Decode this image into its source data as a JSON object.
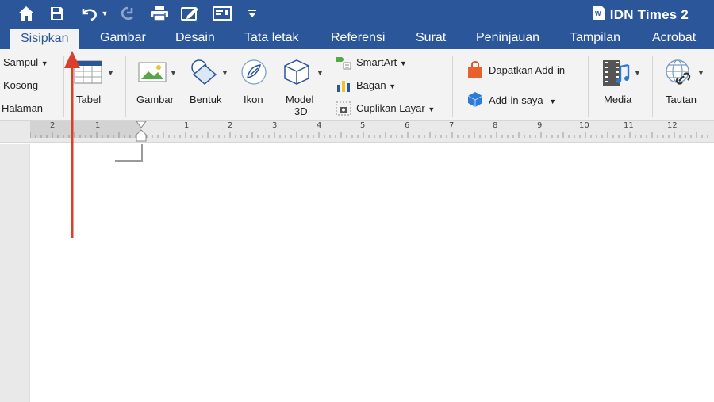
{
  "titlebar": {
    "document_title": "IDN Times 2",
    "icons": [
      "home-icon",
      "save-icon",
      "undo-icon",
      "redo-icon",
      "print-icon",
      "edit-icon",
      "mail-merge-icon",
      "customize-toolbar-icon",
      "word-doc-icon"
    ]
  },
  "tabs": [
    {
      "label": "Sisipkan",
      "active": true
    },
    {
      "label": "Gambar"
    },
    {
      "label": "Desain"
    },
    {
      "label": "Tata letak"
    },
    {
      "label": "Referensi"
    },
    {
      "label": "Surat"
    },
    {
      "label": "Peninjauan"
    },
    {
      "label": "Tampilan"
    },
    {
      "label": "Acrobat"
    }
  ],
  "ribbon": {
    "pages": {
      "cover": "Sampul",
      "blank": "Kosong",
      "break": "Halaman"
    },
    "table": "Tabel",
    "picture": "Gambar",
    "shapes": "Bentuk",
    "icons": "Ikon",
    "model3d_line1": "Model",
    "model3d_line2": "3D",
    "smartart": "SmartArt",
    "chart": "Bagan",
    "screenshot": "Cuplikan Layar",
    "get_addins": "Dapatkan Add-in",
    "my_addins": "Add-in saya",
    "media": "Media",
    "link": "Tautan"
  },
  "ruler": {
    "labels": [
      "2",
      "1",
      "1",
      "2",
      "3",
      "4",
      "5",
      "6",
      "7",
      "8",
      "9",
      "10",
      "11",
      "12"
    ]
  },
  "colors": {
    "accent": "#2b579a",
    "ribbon_bg": "#f3f3f3",
    "annotation_arrow": "#d9402b"
  }
}
